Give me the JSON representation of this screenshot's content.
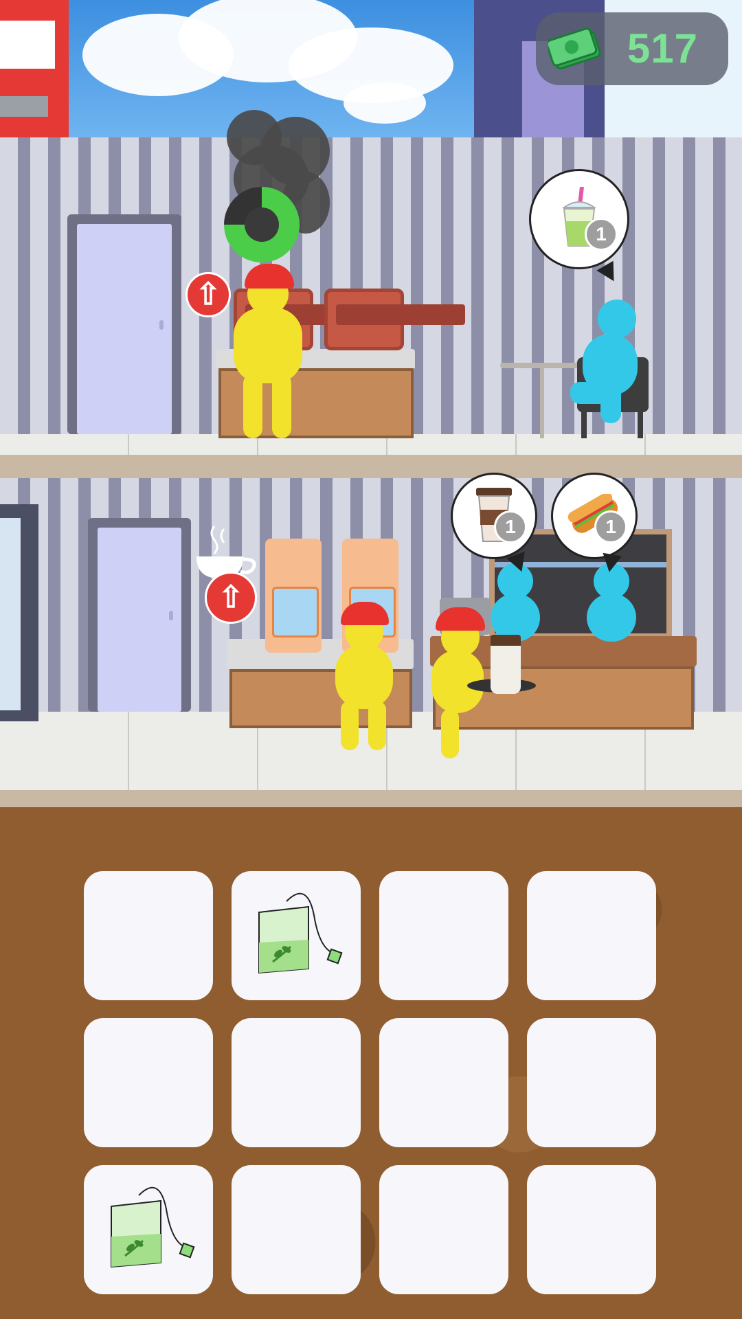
{
  "hud": {
    "money_icon": "cash-icon",
    "money_value": "517"
  },
  "upper_floor": {
    "station": "toaster-station",
    "station_progress": 0.75,
    "upgrade_icon": "arrow-up-icon",
    "customer_order": {
      "item": "bubble-tea-icon",
      "quantity": "1"
    }
  },
  "lower_floor": {
    "station": "coffee-machine-station",
    "upgrade_icon": "arrow-up-icon",
    "customer_orders": [
      {
        "item": "coffee-cup-icon",
        "quantity": "1"
      },
      {
        "item": "sandwich-icon",
        "quantity": "1"
      }
    ]
  },
  "inventory": {
    "rows": 3,
    "cols": 4,
    "slots": [
      {
        "item": ""
      },
      {
        "item": "tea-bag-icon"
      },
      {
        "item": ""
      },
      {
        "item": ""
      },
      {
        "item": ""
      },
      {
        "item": ""
      },
      {
        "item": ""
      },
      {
        "item": ""
      },
      {
        "item": "tea-bag-icon"
      },
      {
        "item": ""
      },
      {
        "item": ""
      },
      {
        "item": ""
      }
    ]
  },
  "colors": {
    "money_text": "#7de296",
    "progress": "#4ccd4a",
    "upgrade_button": "#e53935",
    "worker": "#f3e22b",
    "customer": "#33c8e8"
  }
}
